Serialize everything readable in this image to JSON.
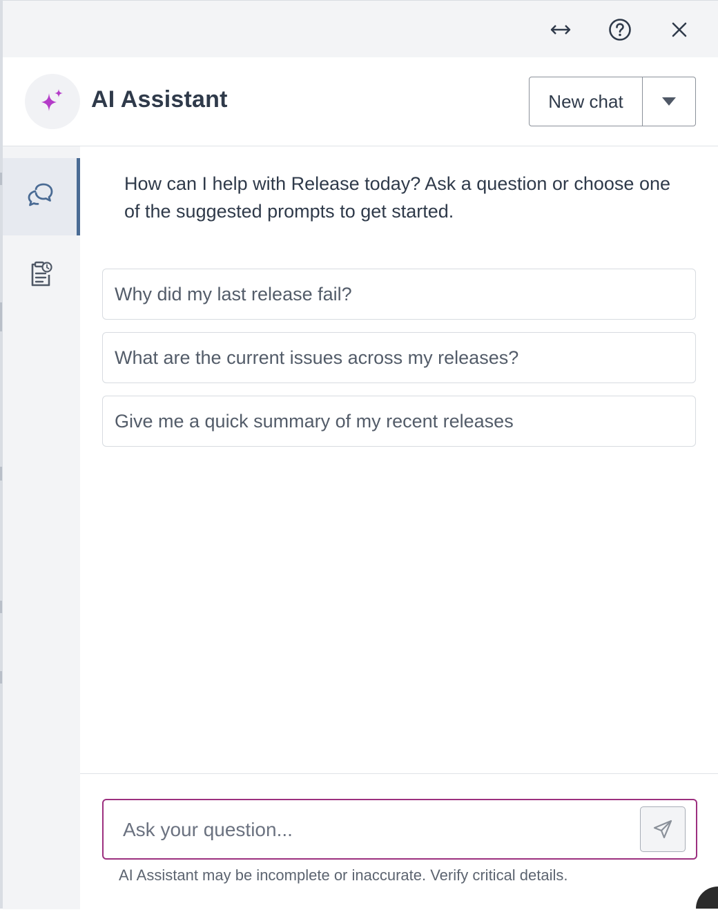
{
  "topbar": {
    "icons": [
      "resize-horizontal-icon",
      "help-circle-icon",
      "close-icon"
    ]
  },
  "header": {
    "title": "AI Assistant",
    "avatar_icon": "sparkle-icon",
    "new_chat_label": "New chat",
    "dropdown_icon": "caret-down-icon"
  },
  "sidenav": {
    "items": [
      {
        "icon": "chat-bubbles-icon",
        "active": true
      },
      {
        "icon": "history-clipboard-icon",
        "active": false
      }
    ]
  },
  "main": {
    "intro": "How can I help with Release today? Ask a question or choose one of the suggested prompts to get started.",
    "prompts": [
      "Why did my last release fail?",
      "What are the current issues across my releases?",
      "Give me a quick summary of my recent releases"
    ]
  },
  "composer": {
    "placeholder": "Ask your question...",
    "send_icon": "send-icon",
    "disclaimer": "AI Assistant may be incomplete or inaccurate. Verify critical details."
  },
  "colors": {
    "accent_purple": "#9c2f7f",
    "sparkle": "#b43cc8",
    "nav_active_border": "#4a6b94",
    "text": "#2f3a4a"
  }
}
